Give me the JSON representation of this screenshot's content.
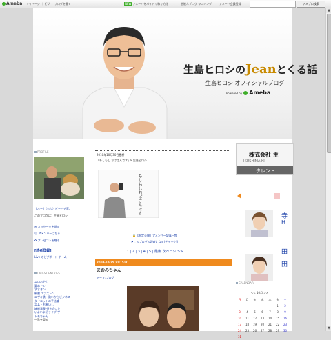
{
  "topbar": {
    "logo": "Ameba",
    "nav": "マイページ ｜ ピグ ｜ ブログを書く",
    "mid_badge": "NEW",
    "mid_text": "アメーバをバイトで稼ぐ方法",
    "right1": "芸能人ブログ ランキング",
    "right2": "アメーバ会員登録",
    "search_button": "アメブロ検索"
  },
  "header": {
    "title_part1": "生島ヒロシの",
    "title_jean": "Jean",
    "title_part2": "とくる話",
    "subtitle": "生島ヒロシ オフィシャルブログ",
    "powered_by": "Powered by",
    "ameba": "Ameba"
  },
  "left": {
    "profile_heading": "PROFILE",
    "profile_caption": "【ルー】（らぶ）ビーパチ家。",
    "profile_name": "このブログは：生島ヒロシ",
    "links": [
      "メッセージを送る",
      "アメンバーになる",
      "プレゼントを贈る"
    ],
    "readership": "[読者登録]",
    "readership_sub": "Live オピグボード ゲーム",
    "latest_heading": "LATEST ENTRIES",
    "entries": [
      "エロおやじ",
      "夏本ドン",
      "すすきン",
      "新書 エプストン",
      "エザキ鉄 - 熱いからビジネス",
      "ダイエットの手法論",
      "エム・お願いし",
      "箱根温泉 行き会いた",
      "いよいよ初ライブ ザー",
      "トモちゃん",
      "一覧を見る"
    ]
  },
  "center": {
    "post1_date": "2010年10月30日更新",
    "post1_title": "「もしもし おばさんです」8 生島ヒロシ",
    "book_title": "もしもしおばさんです",
    "notice1": "【限定公開】アメンバー記事一覧",
    "notice2": "このブログの読者になる(チェック!)",
    "pagination": [
      "1",
      "2",
      "3",
      "4",
      "5",
      "最後",
      "次ページ >>"
    ],
    "post2_date": "2010-10-25 21:15:01",
    "post2_title": "まおみちゃん",
    "post2_theme": "テーマ:ブログ"
  },
  "right": {
    "company_line1": "株式会社 生",
    "company_line2": "IKUSHIMA KI",
    "talent_label": "タレント",
    "talent_names": [
      "寺",
      "H",
      "田",
      "田"
    ],
    "calendar_heading": "CALENDAR",
    "calendar_month": "<< 10月 >>",
    "weekdays": [
      "日",
      "月",
      "火",
      "水",
      "木",
      "金",
      "土"
    ],
    "weeks": [
      [
        "",
        "",
        "",
        "",
        "",
        "1",
        "2"
      ],
      [
        "3",
        "4",
        "5",
        "6",
        "7",
        "8",
        "9"
      ],
      [
        "10",
        "11",
        "12",
        "13",
        "14",
        "15",
        "16"
      ],
      [
        "17",
        "18",
        "19",
        "20",
        "21",
        "22",
        "23"
      ],
      [
        "24",
        "25",
        "26",
        "27",
        "28",
        "29",
        "30"
      ],
      [
        "31",
        "",
        "",
        "",
        "",
        "",
        ""
      ]
    ]
  },
  "colors": {
    "accent": "#ef8a1e",
    "ameba_green": "#3fae2a",
    "title_gold": "#c88a00",
    "link": "#1a3fa8"
  }
}
